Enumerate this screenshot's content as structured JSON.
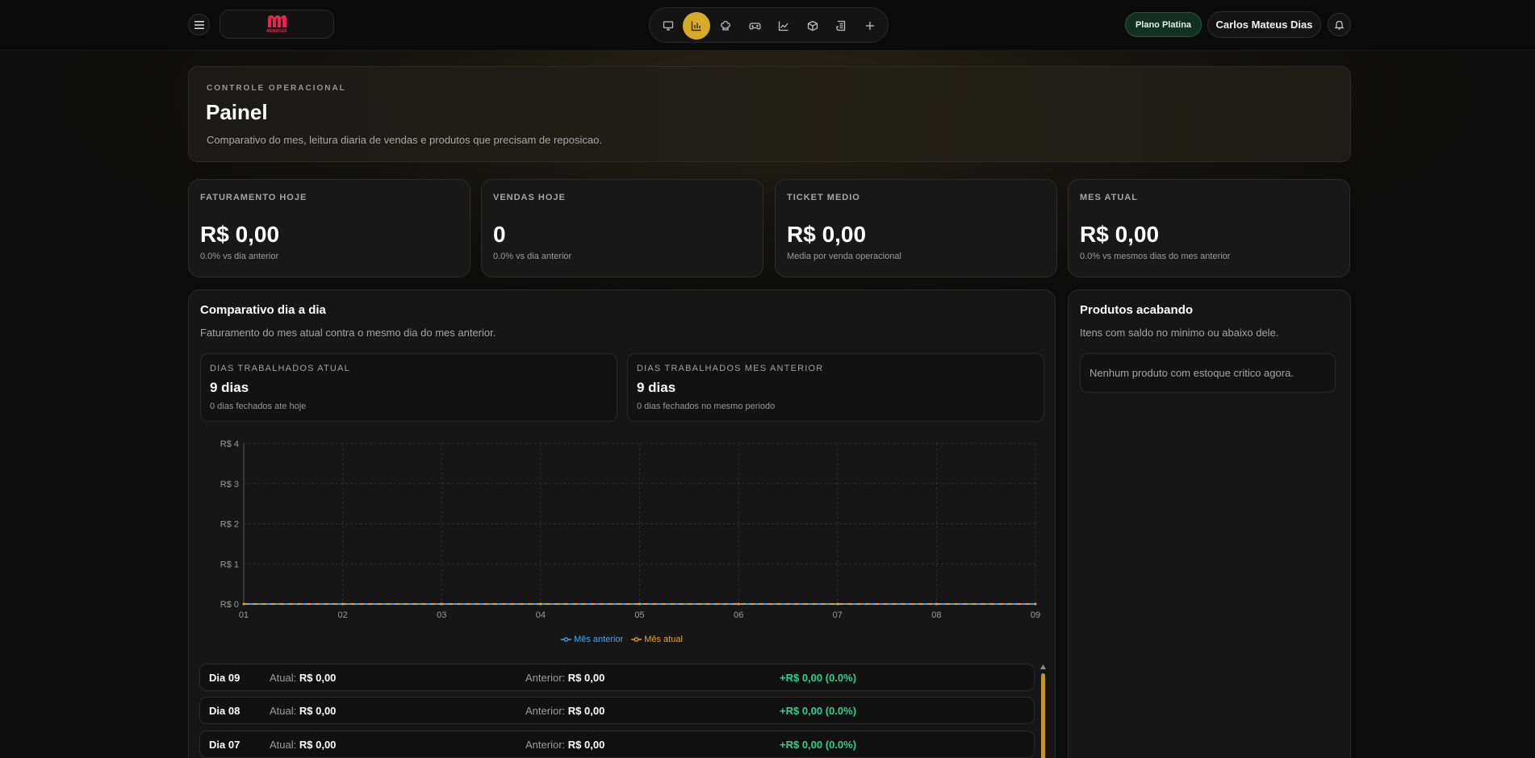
{
  "topbar": {
    "logo_text": "MENDOZA",
    "nav_icons": [
      "monitor-icon",
      "bar-chart-icon",
      "chef-hat-icon",
      "gamepad-icon",
      "line-chart-icon",
      "box-icon",
      "receipt-icon",
      "plus-icon"
    ],
    "active_nav_index": 1,
    "plan_label": "Plano Platina",
    "user_name": "Carlos Mateus Dias"
  },
  "hero": {
    "eyebrow": "CONTROLE OPERACIONAL",
    "title": "Painel",
    "description": "Comparativo do mes, leitura diaria de vendas e produtos que precisam de reposicao."
  },
  "kpis": [
    {
      "label": "FATURAMENTO HOJE",
      "value": "R$ 0,00",
      "sub": "0.0% vs dia anterior"
    },
    {
      "label": "VENDAS HOJE",
      "value": "0",
      "sub": "0.0% vs dia anterior"
    },
    {
      "label": "TICKET MEDIO",
      "value": "R$ 0,00",
      "sub": "Media por venda operacional"
    },
    {
      "label": "MES ATUAL",
      "value": "R$ 0,00",
      "sub": "0.0% vs mesmos dias do mes anterior"
    }
  ],
  "comparison": {
    "title": "Comparativo dia a dia",
    "description": "Faturamento do mes atual contra o mesmo dia do mes anterior.",
    "stats": [
      {
        "label": "DIAS TRABALHADOS ATUAL",
        "value": "9 dias",
        "sub": "0 dias fechados ate hoje"
      },
      {
        "label": "DIAS TRABALHADOS MES ANTERIOR",
        "value": "9 dias",
        "sub": "0 dias fechados no mesmo periodo"
      }
    ],
    "rows": [
      {
        "day": "Dia 09",
        "current_label": "Atual:",
        "current": "R$ 0,00",
        "previous_label": "Anterior:",
        "previous": "R$ 0,00",
        "delta": "+R$ 0,00 (0.0%)"
      },
      {
        "day": "Dia 08",
        "current_label": "Atual:",
        "current": "R$ 0,00",
        "previous_label": "Anterior:",
        "previous": "R$ 0,00",
        "delta": "+R$ 0,00 (0.0%)"
      },
      {
        "day": "Dia 07",
        "current_label": "Atual:",
        "current": "R$ 0,00",
        "previous_label": "Anterior:",
        "previous": "R$ 0,00",
        "delta": "+R$ 0,00 (0.0%)"
      }
    ]
  },
  "stock": {
    "title": "Produtos acabando",
    "description": "Itens com saldo no minimo ou abaixo dele.",
    "empty_message": "Nenhum produto com estoque critico agora."
  },
  "colors": {
    "accent": "#d9a92a",
    "previous_series": "#3fa9f5",
    "current_series": "#e6a52a",
    "positive": "#2fd08a"
  },
  "chart_data": {
    "type": "line",
    "categories": [
      "01",
      "02",
      "03",
      "04",
      "05",
      "06",
      "07",
      "08",
      "09"
    ],
    "series": [
      {
        "name": "Mês anterior",
        "values": [
          0,
          0,
          0,
          0,
          0,
          0,
          0,
          0,
          0
        ],
        "color": "#3fa9f5"
      },
      {
        "name": "Mês atual",
        "values": [
          0,
          0,
          0,
          0,
          0,
          0,
          0,
          0,
          0
        ],
        "color": "#e6a52a"
      }
    ],
    "y_ticks": [
      "R$ 0",
      "R$ 1",
      "R$ 2",
      "R$ 3",
      "R$ 4"
    ],
    "ylim": [
      0,
      4
    ],
    "grid": true,
    "legend_position": "bottom-center"
  }
}
